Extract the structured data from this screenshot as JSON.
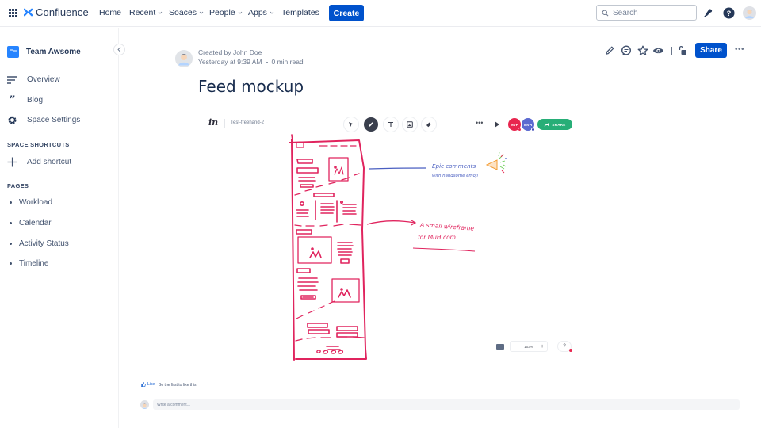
{
  "app": {
    "name": "Confluence",
    "brand_color": "#0052cc",
    "logo_color": "#2684ff"
  },
  "topnav": {
    "items": [
      {
        "label": "Home",
        "has_dropdown": false
      },
      {
        "label": "Recent",
        "has_dropdown": true
      },
      {
        "label": "Soaces",
        "has_dropdown": true
      },
      {
        "label": "People",
        "has_dropdown": true
      },
      {
        "label": "Apps",
        "has_dropdown": true
      },
      {
        "label": "Templates",
        "has_dropdown": false
      }
    ],
    "create_label": "Create",
    "search": {
      "placeholder": "Search",
      "value": ""
    },
    "icons": [
      "notifications-icon",
      "help-icon",
      "profile-avatar"
    ]
  },
  "sidebar": {
    "space_name": "Team Awsome",
    "nav": [
      {
        "label": "Overview",
        "icon": "overview-icon"
      },
      {
        "label": "Blog",
        "icon": "blog-quote-icon"
      },
      {
        "label": "Space Settings",
        "icon": "settings-gear-icon"
      }
    ],
    "shortcuts_heading": "SPACE SHORTCUTS",
    "add_shortcut_label": "Add shortcut",
    "pages_heading": "PAGES",
    "pages": [
      {
        "label": "Workload"
      },
      {
        "label": "Calendar"
      },
      {
        "label": "Activity Status"
      },
      {
        "label": "Timeline"
      }
    ]
  },
  "page": {
    "created_by": "Created by John Doe",
    "timestamp": "Yesterday at 9:39 AM",
    "read_time": "0 min read",
    "title": "Feed mockup",
    "actions": {
      "icons": [
        "edit-icon",
        "comment-icon",
        "star-icon",
        "watch-eye-icon",
        "restrictions-unlock-icon"
      ],
      "share_label": "Share",
      "more_label": "•••"
    }
  },
  "embed": {
    "brand": "in",
    "file_name": "Test-freehand-2",
    "tools": [
      "select-arrow-icon",
      "pen-icon",
      "text-icon",
      "image-icon",
      "eraser-icon"
    ],
    "active_tool": "pen-icon",
    "more_label": "•••",
    "collaborators": [
      {
        "initials": "MVH",
        "color": "#e8264f",
        "status_color": "#e8264f"
      },
      {
        "initials": "MVH",
        "color": "#5b6ad0",
        "status_color": "#3d4ab8"
      }
    ],
    "share_label": "SHARE",
    "share_color": "#27ae77",
    "zoom_level": "103%",
    "zoom_minus": "−",
    "zoom_plus": "+",
    "help_label": "?",
    "annotations": [
      {
        "text_line1": "Epic comments",
        "text_line2": "with handsome emoji",
        "color": "#4a5fc1"
      },
      {
        "text_line1": "A small wireframe",
        "text_line2": "for MuH.com",
        "color": "#e0245e"
      }
    ],
    "sketch_color": "#e0245e"
  },
  "footer": {
    "like_label": "Like",
    "like_note": "Be the first to like this",
    "comment_placeholder": "Write a comment..."
  }
}
